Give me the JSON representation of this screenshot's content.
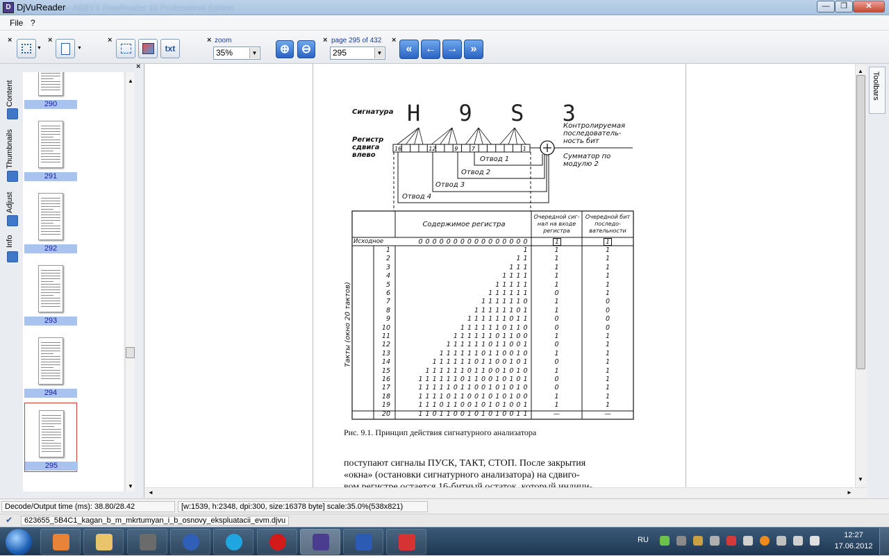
{
  "window": {
    "title": "DjVuReader",
    "blurred_title": "— ABBYY FineReader 10 Professional Edition",
    "min": "—",
    "max": "❐",
    "close": "✕"
  },
  "menu": [
    "File",
    "?"
  ],
  "toolbar": {
    "zoom_label": "zoom",
    "zoom_value": "35%",
    "page_label": "page 295 of 432",
    "page_value": "295",
    "txt_label": "txt",
    "close_glyph": "×"
  },
  "left_tabs": [
    "Content",
    "Thumbnails",
    "Adjust",
    "Info"
  ],
  "thumbnails": [
    {
      "label": "290"
    },
    {
      "label": "291"
    },
    {
      "label": "292"
    },
    {
      "label": "293"
    },
    {
      "label": "294"
    },
    {
      "label": "295"
    }
  ],
  "right_dock": "Toolbars",
  "page": {
    "signature_label": "Сигнатура",
    "signature_chars": "H 9 S 3",
    "register_label": "Регистр сдвига влево",
    "controlled_label": "Контролируемая последователь-ность бит",
    "adder_label": "Сумматор по модулю 2",
    "taps": [
      "Отвод 1",
      "Отвод 2",
      "Отвод 3",
      "Отвод 4"
    ],
    "reg_cells": [
      "16",
      "12",
      "9",
      "7",
      "1"
    ],
    "table_header": "Содержимое регистра",
    "col2_header": "Очередной сиг-нал на входе регистра",
    "col3_header": "Очередной бит последо-вательности",
    "row_label_initial": "Исходное",
    "side_label": "Такты (окно 20 тактов)",
    "initial_row": "0 0 0 0 0 0 0 0 0 0 0 0 0 0 0 0",
    "rows": [
      {
        "n": "1",
        "reg": "1",
        "in": "1",
        "bit": "1"
      },
      {
        "n": "2",
        "reg": "1 1",
        "in": "1",
        "bit": "1"
      },
      {
        "n": "3",
        "reg": "1 1 1",
        "in": "1",
        "bit": "1"
      },
      {
        "n": "4",
        "reg": "1 1 1 1",
        "in": "1",
        "bit": "1"
      },
      {
        "n": "5",
        "reg": "1 1 1 1 1",
        "in": "1",
        "bit": "1"
      },
      {
        "n": "6",
        "reg": "1 1 1 1 1 1",
        "in": "0",
        "bit": "1"
      },
      {
        "n": "7",
        "reg": "1 1 1 1 1 1 0",
        "in": "1",
        "bit": "0"
      },
      {
        "n": "8",
        "reg": "1 1 1 1 1 1 0 1",
        "in": "1",
        "bit": "0"
      },
      {
        "n": "9",
        "reg": "1 1 1 1 1 1 0 1 1",
        "in": "0",
        "bit": "0"
      },
      {
        "n": "10",
        "reg": "1 1 1 1 1 1 0 1 1 0",
        "in": "0",
        "bit": "0"
      },
      {
        "n": "11",
        "reg": "1 1 1 1 1 1 0 1 1 0 0",
        "in": "1",
        "bit": "1"
      },
      {
        "n": "12",
        "reg": "1 1 1 1 1 1 0 1 1 0 0 1",
        "in": "0",
        "bit": "1"
      },
      {
        "n": "13",
        "reg": "1 1 1 1 1 1 0 1 1 0 0 1 0",
        "in": "1",
        "bit": "1"
      },
      {
        "n": "14",
        "reg": "1 1 1 1 1 1 0 1 1 0 0 1 0 1",
        "in": "0",
        "bit": "1"
      },
      {
        "n": "15",
        "reg": "1 1 1 1 1 1 0 1 1 0 0 1 0 1 0",
        "in": "1",
        "bit": "1"
      },
      {
        "n": "16",
        "reg": "1 1 1 1 1 1 0 1 1 0 0 1 0 1 0 1",
        "in": "0",
        "bit": "1"
      },
      {
        "n": "17",
        "reg": "1 1 1 1 1 0 1 1 0 0 1 0 1 0 1 0",
        "in": "0",
        "bit": "1"
      },
      {
        "n": "18",
        "reg": "1 1 1 1 0 1 1 0 0 1 0 1 0 1 0 0",
        "in": "1",
        "bit": "1"
      },
      {
        "n": "19",
        "reg": "1 1 1 0 1 1 0 0 1 0 1 0 1 0 0 1",
        "in": "1",
        "bit": "1"
      },
      {
        "n": "20",
        "reg": "1 1 0 1 1 0 0 1 0 1 0 1 0 0 1 1",
        "in": "—",
        "bit": "—"
      }
    ],
    "caption": "Рис. 9.1. Принцип действия сигнатурного анализатора",
    "body_line1": "поступают сигналы ПУСК, ТАКТ, СТОП. После закрытия",
    "body_line2": "«окна» (остановки сигнатурного  анализатора) на сдвиго-",
    "body_line3": "вом регистре остается 16-битный остаток, который индици-"
  },
  "status": {
    "decode": "Decode/Output time (ms): 38.80/28.42",
    "info": "[w:1539, h:2348, dpi:300, size:16378 byte] scale:35.0%(538x821)"
  },
  "file": {
    "name": "623655_5B4C1_kagan_b_m_mkrtumyan_i_b_osnovy_ekspluatacii_evm.djvu",
    "icon": "checkmark-icon"
  },
  "taskbar": {
    "lang": "RU",
    "time": "12:27",
    "date": "17.06.2012"
  }
}
